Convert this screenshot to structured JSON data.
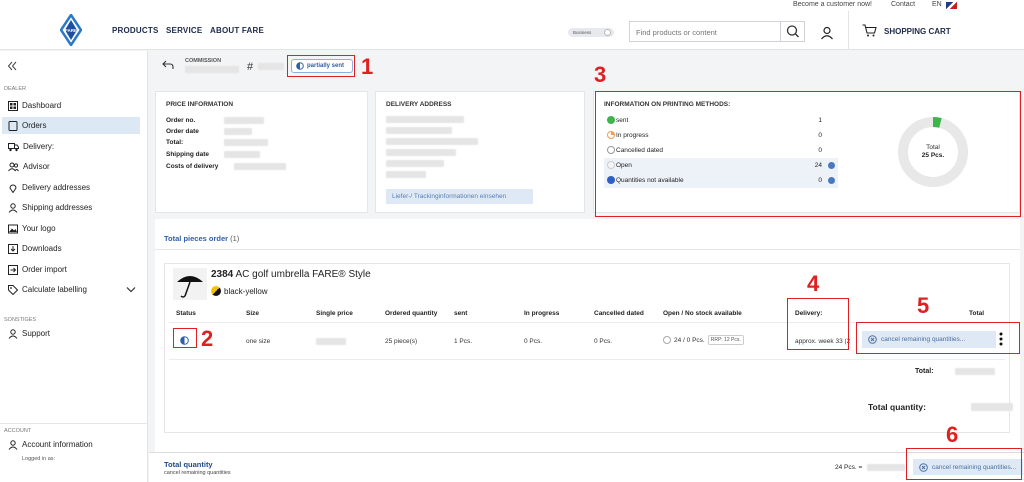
{
  "topbar": {
    "become_customer": "Become a customer now!",
    "contact": "Contact",
    "lang": "EN"
  },
  "header": {
    "logo_text": "FARE",
    "nav": [
      "PRODUCTS",
      "SERVICE",
      "ABOUT FARE"
    ],
    "toggle_label": "Business",
    "search_placeholder": "Find products or content",
    "cart_label": "SHOPPING CART"
  },
  "sidebar": {
    "section_dealer": "DEALER",
    "items": [
      {
        "label": "Dashboard",
        "icon": "speedometer-icon"
      },
      {
        "label": "Orders",
        "icon": "orders-icon"
      },
      {
        "label": "Delivery:",
        "icon": "truck-icon"
      },
      {
        "label": "Advisor",
        "icon": "people-icon"
      },
      {
        "label": "Delivery addresses",
        "icon": "pin-icon"
      },
      {
        "label": "Shipping addresses",
        "icon": "person-pin-icon"
      },
      {
        "label": "Your logo",
        "icon": "image-icon"
      },
      {
        "label": "Downloads",
        "icon": "download-icon"
      },
      {
        "label": "Order import",
        "icon": "import-icon"
      },
      {
        "label": "Calculate labelling",
        "icon": "tag-icon"
      }
    ],
    "section_other": "SONSTIGES",
    "support": "Support",
    "section_account": "ACCOUNT",
    "account_info": "Account information",
    "logged_in": "Logged in as:"
  },
  "commission": {
    "label": "COMMISSION",
    "hash": "#",
    "status_badge": "partially sent"
  },
  "price_info": {
    "title": "PRICE INFORMATION",
    "rows": [
      "Order no.",
      "Order date",
      "Total:",
      "Shipping date",
      "Costs of delivery"
    ]
  },
  "delivery_address": {
    "title": "DELIVERY ADDRESS",
    "tracking_button": "Liefer-/ Trackinginformationen einsehen"
  },
  "printing": {
    "title": "INFORMATION ON PRINTING METHODS:",
    "rows": [
      {
        "name": "sent",
        "count": "1",
        "color": "#3cb54a"
      },
      {
        "name": "In progress",
        "count": "0",
        "color": "#f29c50"
      },
      {
        "name": "Cancelled dated",
        "count": "0",
        "color": "#ffffff"
      },
      {
        "name": "Open",
        "count": "24",
        "color": "#f0f0f0"
      },
      {
        "name": "Quantities not available",
        "count": "0",
        "color": "#2f5fc4"
      }
    ],
    "donut_total_label": "Total",
    "donut_total_value": "25 Pcs.",
    "sent_fraction": 0.04
  },
  "tabs": {
    "total_pieces": "Total pieces order",
    "count": "(1)"
  },
  "product": {
    "number": "2384",
    "name": "AC golf umbrella FARE® Style",
    "color": "black-yellow"
  },
  "table": {
    "headers": [
      "Status",
      "Size",
      "Single price",
      "Ordered quantity",
      "sent",
      "In progress",
      "Cancelled dated",
      "Open / No stock available",
      "Delivery:",
      "Total"
    ],
    "row": {
      "size": "one size",
      "ordered": "25 piece(s)",
      "sent": "1 Pcs.",
      "in_progress": "0 Pcs.",
      "cancelled": "0 Pcs.",
      "open": "24 / 0 Pcs.",
      "rrp": "RRP: 12 Pcs.",
      "delivery": "approx. week 33 (2",
      "cancel_btn": "cancel remaining quantities..."
    },
    "total_label": "Total:",
    "total_quantity_label": "Total quantity:"
  },
  "bottombar": {
    "title": "Total quantity",
    "subtitle": "cancel remaining quantities",
    "pcs": "24 Pcs. =",
    "cancel_btn": "cancel remaining quantities..."
  },
  "annotations": [
    "1",
    "2",
    "3",
    "4",
    "5",
    "6"
  ]
}
